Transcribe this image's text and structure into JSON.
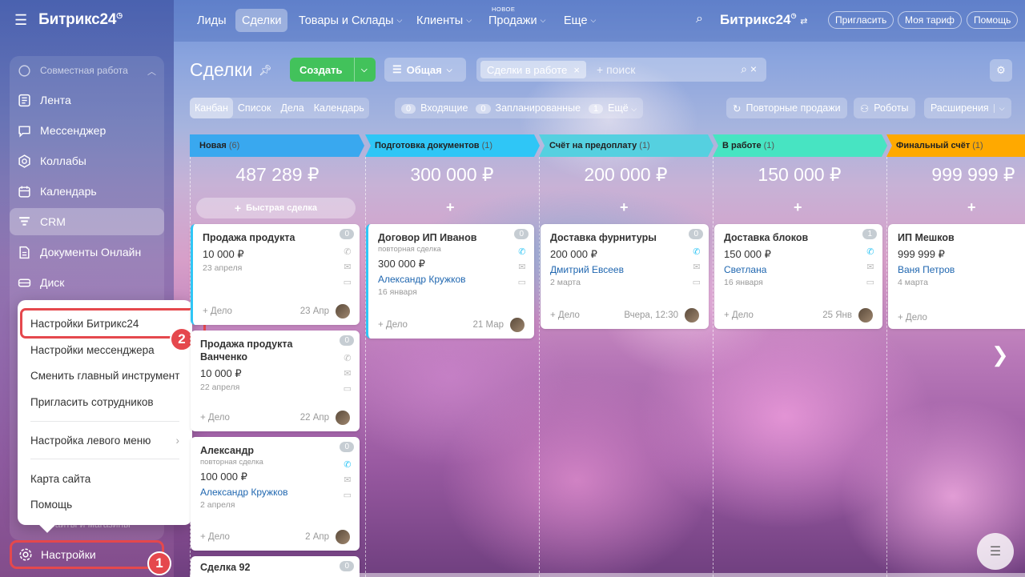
{
  "sidebar": {
    "logo": "Битрикс24",
    "logo_sup": "◷",
    "group": "Совместная работа",
    "items": [
      {
        "label": "Лента"
      },
      {
        "label": "Мессенджер"
      },
      {
        "label": "Коллабы"
      },
      {
        "label": "Календарь"
      },
      {
        "label": "CRM"
      },
      {
        "label": "Документы Онлайн"
      },
      {
        "label": "Диск"
      }
    ],
    "faded": "Сайты и магазины",
    "settings": "Настройки",
    "step1": "1",
    "step2": "2"
  },
  "popup": {
    "items": [
      "Настройки Битрикс24",
      "Настройки мессенджера",
      "Сменить главный инструмент",
      "Пригласить сотрудников",
      "Настройка левого меню",
      "Карта сайта",
      "Помощь"
    ]
  },
  "topnav": {
    "items": [
      "Лиды",
      "Сделки",
      "Товары и Склады",
      "Клиенты",
      "Продажи",
      "Еще"
    ],
    "new_label": "НОВОЕ",
    "logo": "Битрикс24",
    "invite": "Пригласить",
    "tariff": "Моя тариф",
    "help": "Помощь"
  },
  "toolbar": {
    "title": "Сделки",
    "create": "Создать",
    "filter": "Общая",
    "filter_tag": "Сделки в работе",
    "search_placeholder": "+ поиск",
    "views": [
      "Канбан",
      "Список",
      "Дела",
      "Календарь"
    ],
    "counters": [
      {
        "n": "0",
        "label": "Входящие"
      },
      {
        "n": "0",
        "label": "Запланированные"
      },
      {
        "n": "1",
        "label": "Ещё"
      }
    ],
    "repeat": "Повторные продажи",
    "robots": "Роботы",
    "extensions": "Расширения"
  },
  "stages": [
    {
      "name": "Новая",
      "count": "(6)",
      "sum": "487 289 ₽",
      "color": "#39a8ef"
    },
    {
      "name": "Подготовка документов",
      "count": "(1)",
      "sum": "300 000 ₽",
      "color": "#2fc6f6"
    },
    {
      "name": "Счёт на предоплату",
      "count": "(1)",
      "sum": "200 000 ₽",
      "color": "#55d0e0"
    },
    {
      "name": "В работе",
      "count": "(1)",
      "sum": "150 000 ₽",
      "color": "#47e4c2"
    },
    {
      "name": "Финальный счёт",
      "count": "(1)",
      "sum": "999 999 ₽",
      "color": "#ffa900"
    }
  ],
  "quick_deal": "Быстрая сделка",
  "cards": [
    {
      "title": "Продажа продукта",
      "sub": "",
      "price": "10 000 ₽",
      "person": "",
      "date": "23 апреля",
      "badge": "0",
      "add": "+ Дело",
      "when": "23 Апр"
    },
    {
      "title": "Продажа продукта Ванченко",
      "sub": "",
      "price": "10 000 ₽",
      "person": "",
      "date": "22 апреля",
      "badge": "0",
      "add": "+ Дело",
      "when": "22 Апр"
    },
    {
      "title": "Александр",
      "sub": "повторная сделка",
      "price": "100 000 ₽",
      "person": "Александр Кружков",
      "date": "2 апреля",
      "badge": "0",
      "add": "+ Дело",
      "when": "2 Апр"
    },
    {
      "title": "Сделка 92",
      "sub": "",
      "price": "",
      "person": "",
      "date": "",
      "badge": "0",
      "add": "",
      "when": ""
    },
    {
      "title": "Договор ИП Иванов",
      "sub": "повторная сделка",
      "price": "300 000 ₽",
      "person": "Александр Кружков",
      "date": "16 января",
      "badge": "0",
      "add": "+ Дело",
      "when": "21 Мар"
    },
    {
      "title": "Доставка фурнитуры",
      "sub": "",
      "price": "200 000 ₽",
      "person": "Дмитрий Евсеев",
      "date": "2 марта",
      "badge": "0",
      "add": "+ Дело",
      "when": "Вчера, 12:30"
    },
    {
      "title": "Доставка блоков",
      "sub": "",
      "price": "150 000 ₽",
      "person": "Светлана",
      "date": "16 января",
      "badge": "1",
      "add": "+ Дело",
      "when": "25 Янв"
    },
    {
      "title": "ИП Мешков",
      "sub": "",
      "price": "999 999 ₽",
      "person": "Ваня Петров",
      "date": "4 марта",
      "badge": "",
      "add": "+ Дело",
      "when": ""
    }
  ]
}
